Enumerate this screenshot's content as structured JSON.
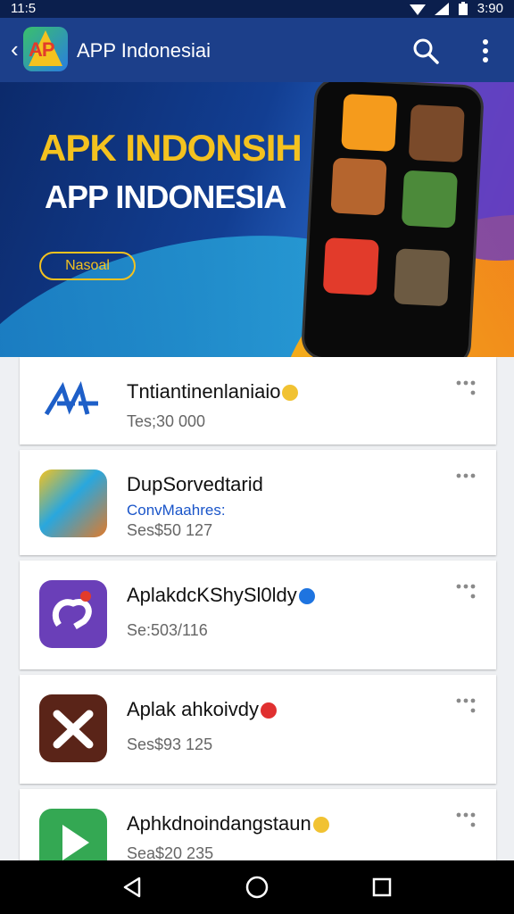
{
  "status_bar": {
    "time": "11:5",
    "clock_right": "3:90"
  },
  "app_bar": {
    "title": "APP Indonesiai",
    "logo_text": "AP"
  },
  "banner": {
    "headline_1": "APK INDONSIH",
    "headline_2": "APP INDONESIA",
    "button_label": "Nasoal"
  },
  "apps": [
    {
      "name": "Tntiantinenlaniaio",
      "subtitle": "",
      "meta": "Tes;30 000",
      "badge_color": "#f1c232"
    },
    {
      "name": "DupSorvedtarid",
      "subtitle": "ConvMaahres:",
      "meta": "Ses$50 127",
      "badge_color": ""
    },
    {
      "name": "AplakdcKShySl0ldy",
      "subtitle": "",
      "meta": "Se:503/116",
      "badge_color": "#1e74e0"
    },
    {
      "name": "Aplak ahkoivdy",
      "subtitle": "",
      "meta": "Ses$93 125",
      "badge_color": "#e03030"
    },
    {
      "name": "Aphkdnoindangstaun",
      "subtitle": "",
      "meta": "Sea$20 235",
      "badge_color": "#f1c232"
    }
  ],
  "icons": [
    "back-arrow-icon",
    "search-icon",
    "more-vert-icon",
    "drag-dots-icon",
    "nav-back-icon",
    "nav-home-icon",
    "nav-recents-icon"
  ],
  "colors": {
    "app_bar": "#1c3f8a",
    "accent_yellow": "#f4c21f",
    "link_blue": "#1a55c9"
  }
}
